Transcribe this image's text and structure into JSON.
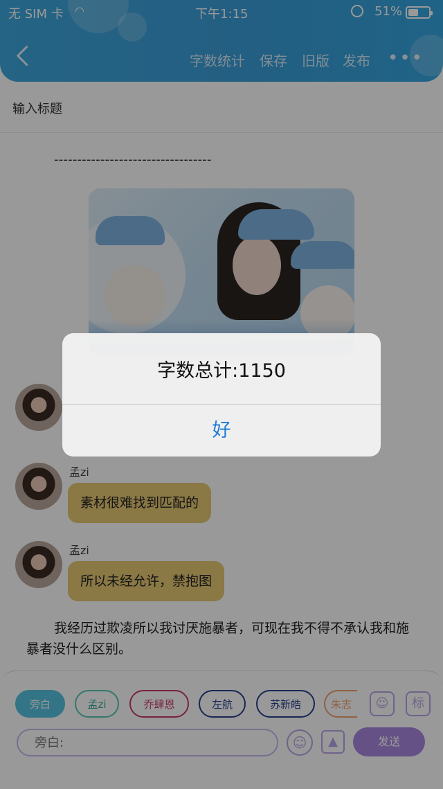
{
  "status_bar": {
    "carrier": "无 SIM 卡",
    "time": "下午1:15",
    "battery_percent": "51%",
    "battery_level": 0.51
  },
  "toolbar": {
    "word_count_label": "字数统计",
    "save_label": "保存",
    "old_version_label": "旧版",
    "publish_label": "发布"
  },
  "title_field": {
    "placeholder": "输入标题"
  },
  "content": {
    "divider_text": "----------------------------------",
    "messages": [
      {
        "name": "孟zi",
        "text": "素材很难找到匹配的"
      },
      {
        "name": "孟zi",
        "text": "所以未经允许，禁抱图"
      }
    ],
    "narration": "我经历过欺凌所以我讨厌施暴者，可现在我不得不承认我和施暴者没什么区别。"
  },
  "character_chips": [
    {
      "label": "旁白",
      "active": true,
      "color": "#55c1e1"
    },
    {
      "label": "孟zi",
      "active": false,
      "color": "#56c7b5"
    },
    {
      "label": "乔肆恩",
      "active": false,
      "color": "#c9386b"
    },
    {
      "label": "左航",
      "active": false,
      "color": "#27408c"
    },
    {
      "label": "苏新皓",
      "active": false,
      "color": "#27408c"
    },
    {
      "label": "朱志",
      "active": false,
      "color": "#f0a070"
    }
  ],
  "bottom_icons": {
    "mark_label": "标"
  },
  "composer": {
    "placeholder": "旁白:",
    "send_label": "发送"
  },
  "dialog": {
    "message": "字数总计:1150",
    "ok_label": "好"
  },
  "colors": {
    "header": "#3b9ed9",
    "bubble": "#e7c873",
    "accent_purple": "#a987e0",
    "ok_blue": "#1d7bd8"
  }
}
